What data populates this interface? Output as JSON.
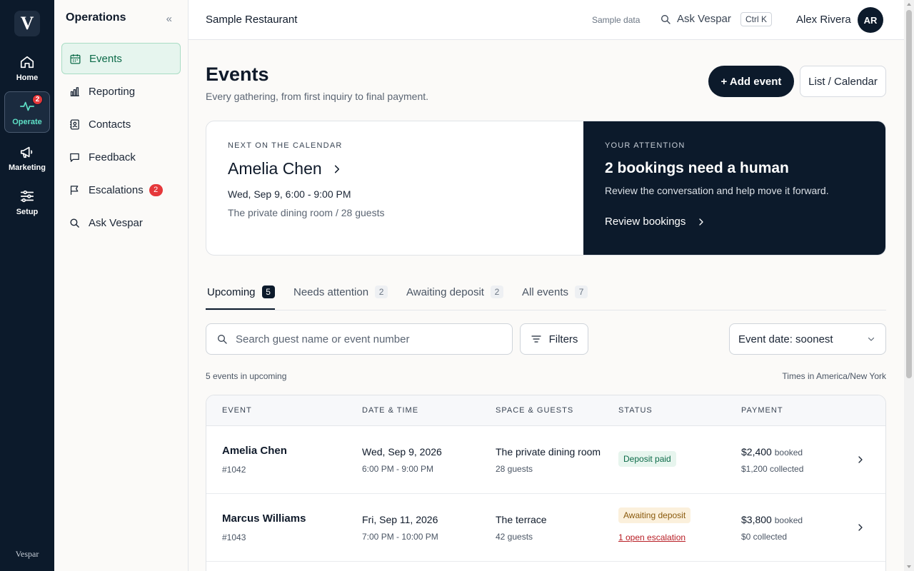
{
  "app": {
    "logo_letter": "V",
    "brand_footer": "Vespar",
    "accent_color": "#0c1a2b",
    "success_color": "#0d6b49",
    "danger_color": "#e5383b"
  },
  "rail": {
    "items": [
      {
        "label": "Home",
        "icon": "home-icon"
      },
      {
        "label": "Operate",
        "icon": "pulse-icon",
        "badge": "2"
      },
      {
        "label": "Marketing",
        "icon": "megaphone-icon"
      },
      {
        "label": "Setup",
        "icon": "sliders-icon"
      }
    ]
  },
  "sidenav": {
    "title": "Operations",
    "collapse_glyph": "«",
    "items": [
      {
        "label": "Events",
        "icon": "calendar-icon"
      },
      {
        "label": "Reporting",
        "icon": "bar-chart-icon"
      },
      {
        "label": "Contacts",
        "icon": "contact-book-icon"
      },
      {
        "label": "Feedback",
        "icon": "chat-bubble-icon"
      },
      {
        "label": "Escalations",
        "icon": "flag-icon",
        "badge": "2"
      },
      {
        "label": "Ask Vespar",
        "icon": "search-icon"
      }
    ]
  },
  "topbar": {
    "restaurant": "Sample Restaurant",
    "sample_data": "Sample data",
    "ask_label": "Ask Vespar",
    "shortcut": "Ctrl K",
    "user_name": "Alex Rivera",
    "user_initials": "AR"
  },
  "page": {
    "title": "Events",
    "subtitle": "Every gathering, from first inquiry to final payment.",
    "add_button": "+ Add event",
    "view_toggle": "List / Calendar"
  },
  "hero": {
    "next": {
      "eyebrow": "NEXT ON THE CALENDAR",
      "name": "Amelia Chen",
      "date": "Wed, Sep 9, 6:00 - 9:00 PM",
      "space": "The private dining room / 28 guests"
    },
    "attention": {
      "eyebrow": "YOUR ATTENTION",
      "title": "2 bookings need a human",
      "description": "Review the conversation and help move it forward.",
      "link": "Review bookings"
    }
  },
  "tabs": [
    {
      "label": "Upcoming",
      "count": "5"
    },
    {
      "label": "Needs attention",
      "count": "2"
    },
    {
      "label": "Awaiting deposit",
      "count": "2"
    },
    {
      "label": "All events",
      "count": "7"
    }
  ],
  "toolbar": {
    "search_placeholder": "Search guest name or event number",
    "filters_label": "Filters",
    "sort_label": "Event date: soonest"
  },
  "summary": {
    "count_text": "5 events in upcoming",
    "timezone_text": "Times in America/New York"
  },
  "table": {
    "columns": [
      "EVENT",
      "DATE & TIME",
      "SPACE & GUESTS",
      "STATUS",
      "PAYMENT"
    ],
    "rows": [
      {
        "guest": "Amelia Chen",
        "event_number": "#1042",
        "date": "Wed, Sep 9, 2026",
        "time": "6:00 PM - 9:00 PM",
        "space": "The private dining room",
        "guests": "28 guests",
        "status": "Deposit paid",
        "escalation": "",
        "booked": "$2,400",
        "booked_label": "booked",
        "collected": "$1,200 collected"
      },
      {
        "guest": "Marcus Williams",
        "event_number": "#1043",
        "date": "Fri, Sep 11, 2026",
        "time": "7:00 PM - 10:00 PM",
        "space": "The terrace",
        "guests": "42 guests",
        "status": "Awaiting deposit",
        "escalation": "1 open escalation",
        "booked": "$3,800",
        "booked_label": "booked",
        "collected": "$0 collected"
      }
    ]
  }
}
